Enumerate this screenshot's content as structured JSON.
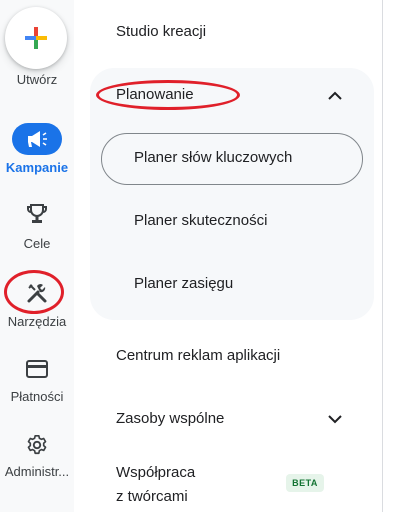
{
  "rail": {
    "create_label": "Utwórz",
    "items": [
      {
        "label": "Kampanie",
        "icon": "megaphone-icon"
      },
      {
        "label": "Cele",
        "icon": "trophy-icon"
      },
      {
        "label": "Narzędzia",
        "icon": "tools-icon"
      },
      {
        "label": "Płatności",
        "icon": "credit-card-icon"
      },
      {
        "label": "Administr...",
        "icon": "gear-icon"
      }
    ]
  },
  "menu": {
    "items": {
      "studio": "Studio kreacji",
      "planning": "Planowanie",
      "keyword_planner": "Planer słów kluczowych",
      "performance_planner": "Planer skuteczności",
      "reach_planner": "Planer zasięgu",
      "app_ads_hub": "Centrum reklam aplikacji",
      "shared_library": "Zasoby wspólne",
      "creator_line1": "Współpraca",
      "creator_line2": "z twórcami",
      "beta": "BETA"
    }
  },
  "colors": {
    "accent": "#1a73e8",
    "annotation": "#e0202a",
    "beta_bg": "#e6f4ea",
    "beta_fg": "#137333"
  }
}
